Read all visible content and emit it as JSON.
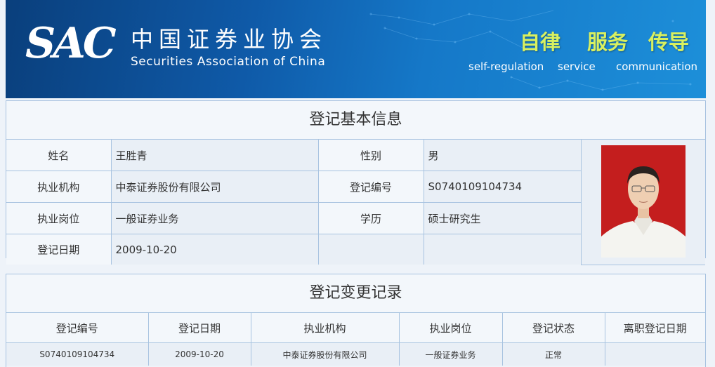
{
  "header": {
    "logo_abbr": "SAC",
    "logo_cn": "中国证券业协会",
    "logo_en": "Securities Association of China",
    "slogans": [
      {
        "cn": "自律",
        "en": "self-regulation"
      },
      {
        "cn": "服务",
        "en": "service"
      },
      {
        "cn": "传导",
        "en": "communication"
      }
    ]
  },
  "basic_info": {
    "title": "登记基本信息",
    "rows": [
      {
        "label1": "姓名",
        "value1": "王胜青",
        "label2": "性别",
        "value2": "男"
      },
      {
        "label1": "执业机构",
        "value1": "中泰证券股份有限公司",
        "label2": "登记编号",
        "value2": "S0740109104734"
      },
      {
        "label1": "执业岗位",
        "value1": "一般证券业务",
        "label2": "学历",
        "value2": "硕士研究生"
      },
      {
        "label1": "登记日期",
        "value1": "2009-10-20",
        "label2": "",
        "value2": ""
      }
    ]
  },
  "change_records": {
    "title": "登记变更记录",
    "columns": [
      "登记编号",
      "登记日期",
      "执业机构",
      "执业岗位",
      "登记状态",
      "离职登记日期"
    ],
    "rows": [
      [
        "S0740109104734",
        "2009-10-20",
        "中泰证券股份有限公司",
        "一般证券业务",
        "正常",
        ""
      ]
    ]
  },
  "colors": {
    "banner_dark": "#0a3f7c",
    "banner_light": "#1d8fd9",
    "slogan": "#d8f060",
    "border": "#a8c3e0",
    "photo_bg": "#c41e1e"
  }
}
